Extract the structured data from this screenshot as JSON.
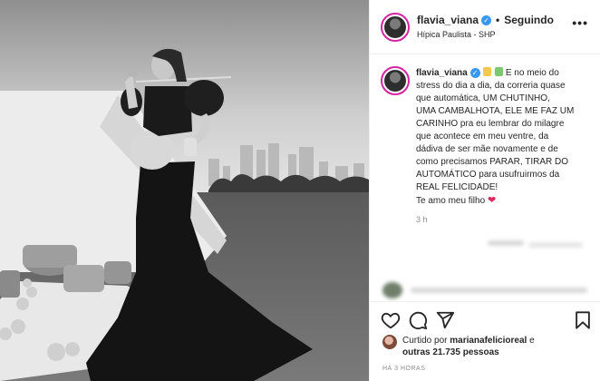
{
  "post": {
    "username": "flavia_viana",
    "verified_mark": "✓",
    "separator": "•",
    "follow_state": "Seguindo",
    "location": "Hípica Paulista - SHP",
    "more_label": "•••"
  },
  "caption": {
    "username": "flavia_viana",
    "emoji_names": [
      "baby-bottle-emoji",
      "sparkles-emoji"
    ],
    "lines": [
      "E no meio do",
      "stress do dia a dia, da correria quase",
      "que automática, UM CHUTINHO,",
      "UMA CAMBALHOTA, ELE ME FAZ UM",
      "CARINHO pra eu lembrar do milagre",
      "que acontece em meu ventre, da",
      "dádiva de ser mãe novamente e de",
      "como precisamos PARAR, TIRAR DO",
      "AUTOMÁTICO para usufruirmos da",
      "REAL FELICIDADE!",
      "Te amo meu filho"
    ],
    "heart": "❤",
    "time": "3 h"
  },
  "actions": {
    "icons": [
      "heart-icon",
      "comment-icon",
      "share-icon",
      "bookmark-icon"
    ]
  },
  "likes": {
    "prefix": "Curtido por",
    "liker": "marianafelicioreal",
    "connector": "e",
    "others": "outras 21.735 pessoas"
  },
  "timeago": "HÁ 3 HORAS",
  "colors": {
    "verified": "#3897f0",
    "story_ring": "#d6249f",
    "heart": "#e0245e",
    "muted": "#8e8e8e"
  }
}
